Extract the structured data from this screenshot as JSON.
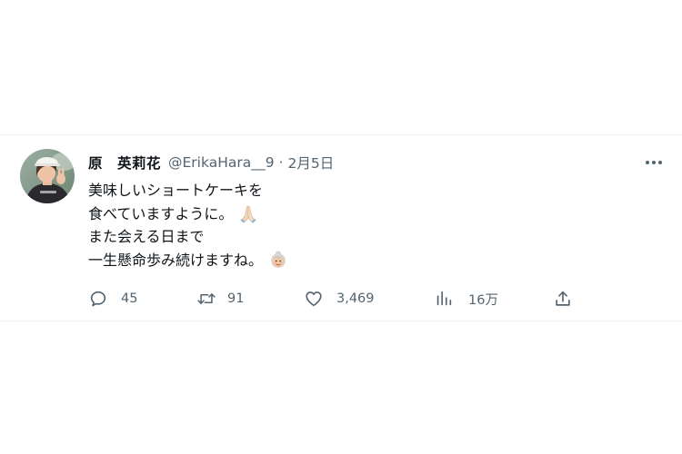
{
  "tweet": {
    "display_name": "原　英莉花",
    "handle": "@ErikaHara__9",
    "separator": "·",
    "date": "2月5日",
    "lines": [
      "美味しいショートケーキを",
      "食べていますように。",
      "また会える日まで",
      "一生懸命歩み続けますね。"
    ],
    "emojis": [
      "folded-hands-emoji",
      "old-woman-emoji"
    ]
  },
  "actions": {
    "reply_count": "45",
    "retweet_count": "91",
    "like_count": "3,469",
    "views_count": "16万"
  },
  "colors": {
    "text_primary": "#0f1419",
    "text_secondary": "#536471",
    "border": "#eff3f4",
    "background": "#ffffff"
  }
}
